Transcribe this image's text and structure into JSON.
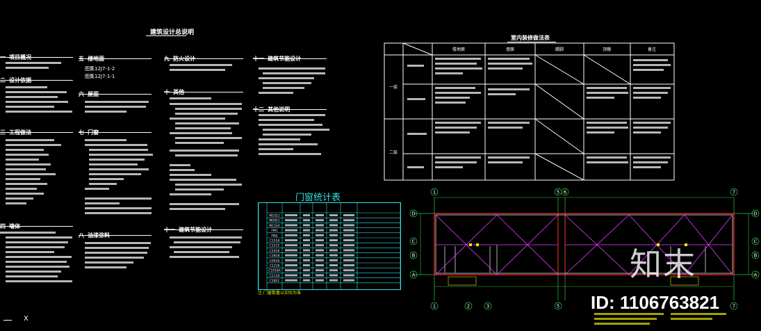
{
  "main_title": "建筑设计总说明",
  "sections": [
    {
      "num": "一",
      "title": "项目概况"
    },
    {
      "num": "二",
      "title": "设计依据"
    },
    {
      "num": "三",
      "title": "工程做法"
    },
    {
      "num": "四",
      "title": "墙体"
    },
    {
      "num": "五",
      "title": "楼地面"
    },
    {
      "num": "六",
      "title": "屋面"
    },
    {
      "num": "七",
      "title": "门窗"
    },
    {
      "num": "八",
      "title": "油漆涂料"
    },
    {
      "num": "九",
      "title": "防火设计"
    },
    {
      "num": "十",
      "title": "其他"
    },
    {
      "num": "十一",
      "title": "建筑节能设计"
    },
    {
      "num": "十二",
      "title": "其他说明"
    }
  ],
  "atlas_refs": [
    "图集12J7-1-2",
    "图集12J7-1-1"
  ],
  "room_table": {
    "title": "室内装修做法表",
    "col_headers": [
      "楼地面",
      "墙面",
      "踢脚",
      "顶棚",
      "备注"
    ],
    "floor_labels": [
      "一层",
      "二层"
    ]
  },
  "door_window_table": {
    "title": "门窗统计表",
    "codes": [
      "M1021",
      "M0921",
      "M1524",
      "FM1",
      "FM2",
      "C1518",
      "C1215",
      "C2418",
      "C1818",
      "C0918",
      "C1218",
      "C1818A",
      "C2118",
      "C1821"
    ],
    "note": "注:门窗数量以实际为准"
  },
  "plan": {
    "col_axes_top": [
      "1",
      "5",
      "6",
      "7"
    ],
    "col_axes_bottom": [
      "1",
      "2",
      "3",
      "5",
      "7"
    ],
    "row_axes": [
      "D",
      "C",
      "B",
      "A"
    ]
  },
  "watermark": {
    "brand": "知末",
    "id_text": "ID: 1106763821"
  },
  "colors": {
    "background": "#000000",
    "cyan": "#2ee6e6",
    "magenta": "#e040ff",
    "red": "#ff3030",
    "yellow": "#e8e800",
    "green": "#2ecc40"
  }
}
